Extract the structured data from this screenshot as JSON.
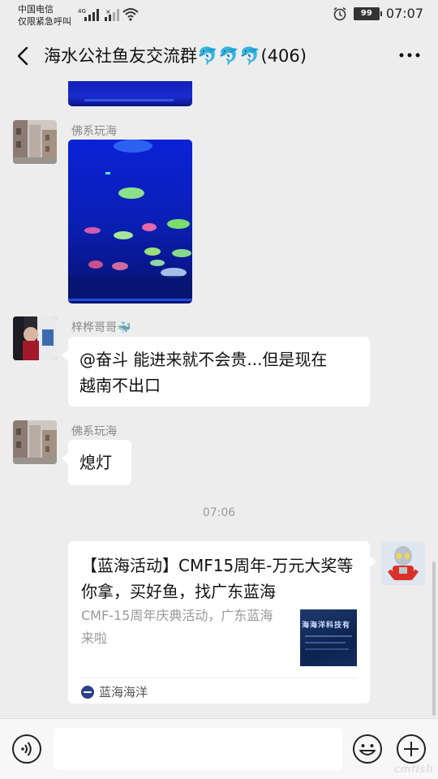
{
  "status_bar": {
    "carrier_line1": "中国电信",
    "carrier_line2": "仅限紧急呼叫",
    "network": "4G",
    "battery": "99",
    "time": "07:07"
  },
  "nav": {
    "title": "海水公社鱼友交流群🐬🐬🐬(406)"
  },
  "messages": [
    {
      "type": "image",
      "sender": ""
    },
    {
      "type": "image",
      "sender": "佛系玩海"
    },
    {
      "type": "text",
      "sender": "梓桦哥哥🐳",
      "text_line1": "@奋斗  能进来就不会贵...但是现在",
      "text_line2": "越南不出口"
    },
    {
      "type": "text",
      "sender": "佛系玩海",
      "text": "熄灯"
    }
  ],
  "timestamp": "07:06",
  "card": {
    "title": "【蓝海活动】CMF15周年-万元大奖等你拿，买好鱼，找广东蓝海",
    "desc": "CMF-15周年庆典活动，广东蓝海来啦",
    "thumb_text": "海海洋科技有",
    "source": "蓝海海洋"
  },
  "input": {
    "placeholder": ""
  },
  "watermark": "cmfish"
}
